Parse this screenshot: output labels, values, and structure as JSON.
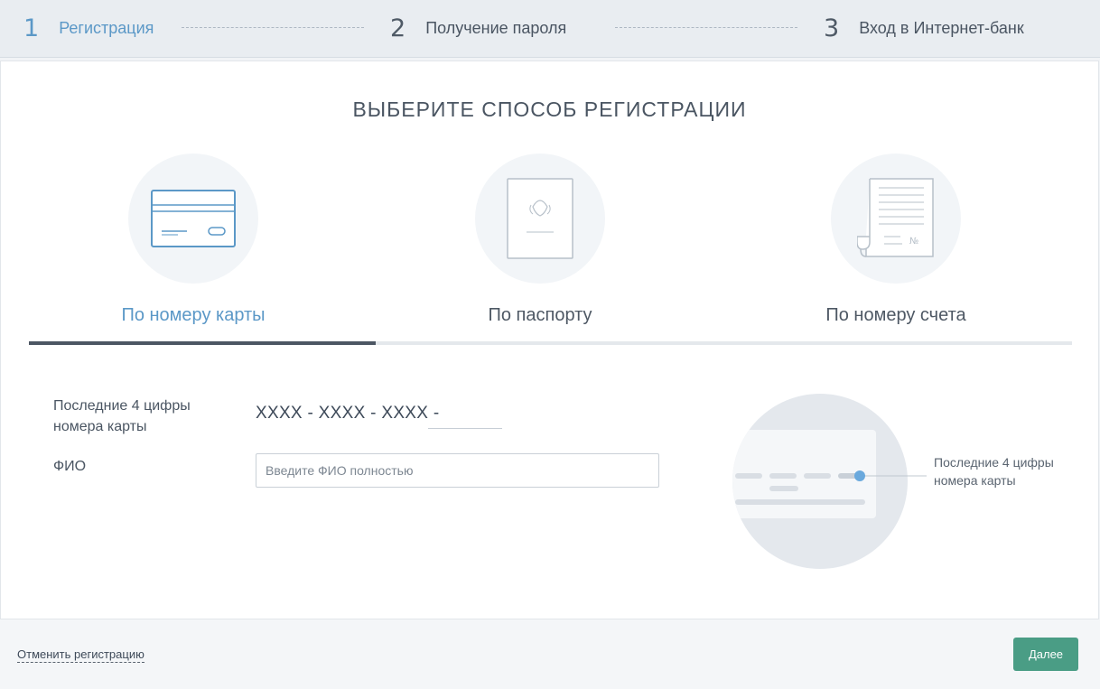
{
  "steps": [
    {
      "number": "1",
      "label": "Регистрация",
      "active": true
    },
    {
      "number": "2",
      "label": "Получение пароля",
      "active": false
    },
    {
      "number": "3",
      "label": "Вход в Интернет-банк",
      "active": false
    }
  ],
  "main": {
    "title": "ВЫБЕРИТЕ СПОСОБ РЕГИСТРАЦИИ",
    "methods": [
      {
        "label": "По номеру карты",
        "icon": "credit-card-icon",
        "active": true
      },
      {
        "label": "По паспорту",
        "icon": "passport-icon",
        "active": false
      },
      {
        "label": "По номеру счета",
        "icon": "account-document-icon",
        "active": false
      }
    ]
  },
  "form": {
    "card_digits_label": "Последние 4 цифры номера карты",
    "card_mask": "XXXX - XXXX - XXXX -",
    "card_digits_value": "",
    "fio_label": "ФИО",
    "fio_placeholder": "Введите ФИО полностью",
    "fio_value": ""
  },
  "illustration": {
    "hint": "Последние 4 цифры номера карты"
  },
  "footer": {
    "cancel_label": "Отменить регистрацию",
    "next_label": "Далее"
  },
  "colors": {
    "accent_blue": "#5b98c7",
    "button_green": "#4a9d85",
    "tab_active": "#4c5663"
  }
}
